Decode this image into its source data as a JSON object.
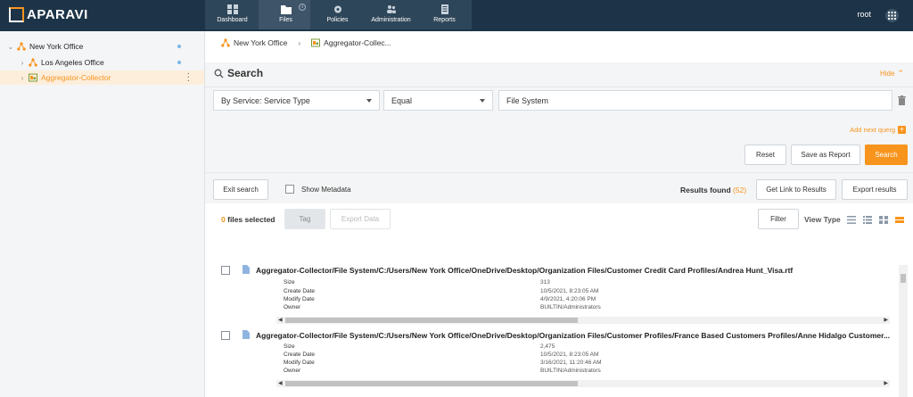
{
  "app": {
    "logo_text": "APARAVI",
    "user": "root"
  },
  "nav": [
    {
      "label": "Dashboard",
      "icon": "dashboard-icon"
    },
    {
      "label": "Files",
      "icon": "folder-icon",
      "active": true
    },
    {
      "label": "Policies",
      "icon": "gear-icon"
    },
    {
      "label": "Administration",
      "icon": "users-icon"
    },
    {
      "label": "Reports",
      "icon": "report-icon"
    }
  ],
  "sidebar": {
    "items": [
      {
        "label": "New York Office",
        "icon": "network-node-icon"
      },
      {
        "label": "Los Angeles Office",
        "icon": "network-node-icon"
      },
      {
        "label": "Aggregator-Collector",
        "icon": "collector-icon",
        "selected": true
      }
    ]
  },
  "breadcrumb": [
    "New York Office",
    "Aggregator-Collec..."
  ],
  "search": {
    "title": "Search",
    "hide_label": "Hide",
    "field": "By Service: Service Type",
    "operator": "Equal",
    "value": "File System",
    "add_query": "Add next querg",
    "reset": "Reset",
    "save_report": "Save as Report",
    "search_btn": "Search"
  },
  "toolbar": {
    "exit_search": "Exit search",
    "show_metadata": "Show Metadata",
    "results_label": "Results found",
    "results_count": "(52)",
    "get_link": "Get Link to Results",
    "export_results": "Export results",
    "files_selected_count": "0",
    "files_selected_label": "files selected",
    "tag": "Tag",
    "export_data": "Export Data",
    "filter": "Filter",
    "view_type": "View Type"
  },
  "meta_labels": [
    "Size",
    "Create Date",
    "Modify Date",
    "Owner"
  ],
  "results": [
    {
      "path": "Aggregator-Collector/File System/C:/Users/New York Office/OneDrive/Desktop/Organization Files/Customer Credit Card Profiles/Andrea Hunt_Visa.rtf",
      "size": "313",
      "create": "10/5/2021, 8:23:05 AM",
      "modify": "4/9/2021, 4:20:06 PM",
      "owner": "BUILTIN/Administrators"
    },
    {
      "path": "Aggregator-Collector/File System/C:/Users/New York Office/OneDrive/Desktop/Organization Files/Customer Profiles/France Based Customers Profiles/Anne Hidalgo Customer...",
      "size": "2,475",
      "create": "10/5/2021, 8:23:05 AM",
      "modify": "3/16/2021, 11:20:46 AM",
      "owner": "BUILTIN/Administrators"
    }
  ]
}
